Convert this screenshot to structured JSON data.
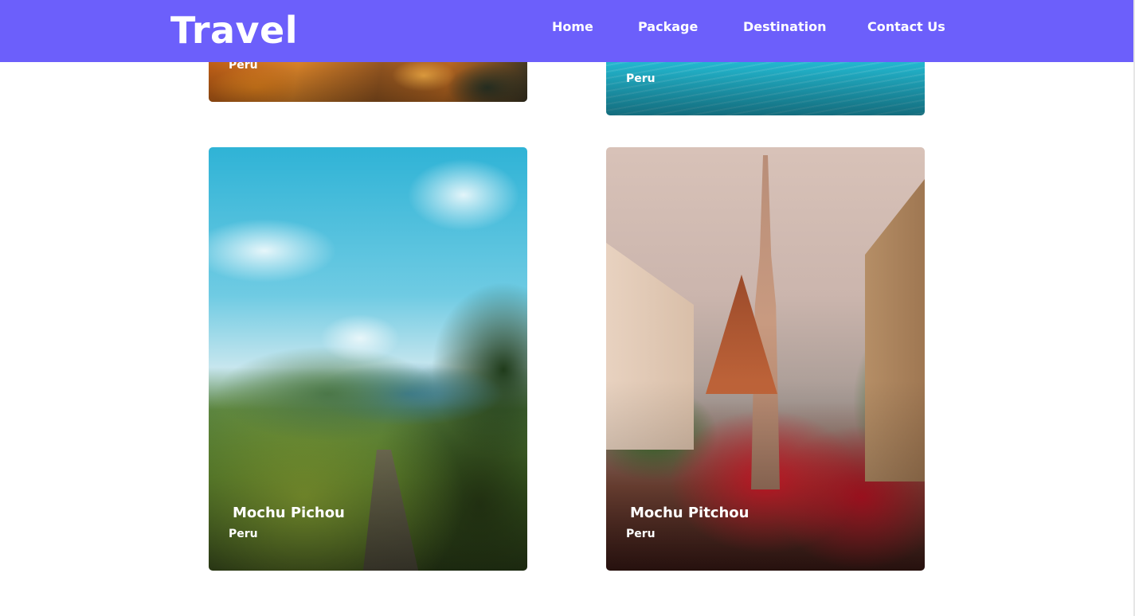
{
  "header": {
    "brand": "Travel",
    "nav": [
      {
        "label": "Home"
      },
      {
        "label": "Package"
      },
      {
        "label": "Destination"
      },
      {
        "label": "Contact Us"
      }
    ],
    "accent_color": "#6c5ffb"
  },
  "cards": [
    {
      "title": "",
      "subtitle": "Peru",
      "image": "orange-flowers-photo"
    },
    {
      "title": "",
      "subtitle": "Peru",
      "image": "turquoise-water-photo"
    },
    {
      "title": "Mochu Pichou",
      "subtitle": "Peru",
      "image": "coastal-hills-photo"
    },
    {
      "title": "Mochu Pitchou",
      "subtitle": "Peru",
      "image": "cathedral-flowers-photo"
    }
  ]
}
